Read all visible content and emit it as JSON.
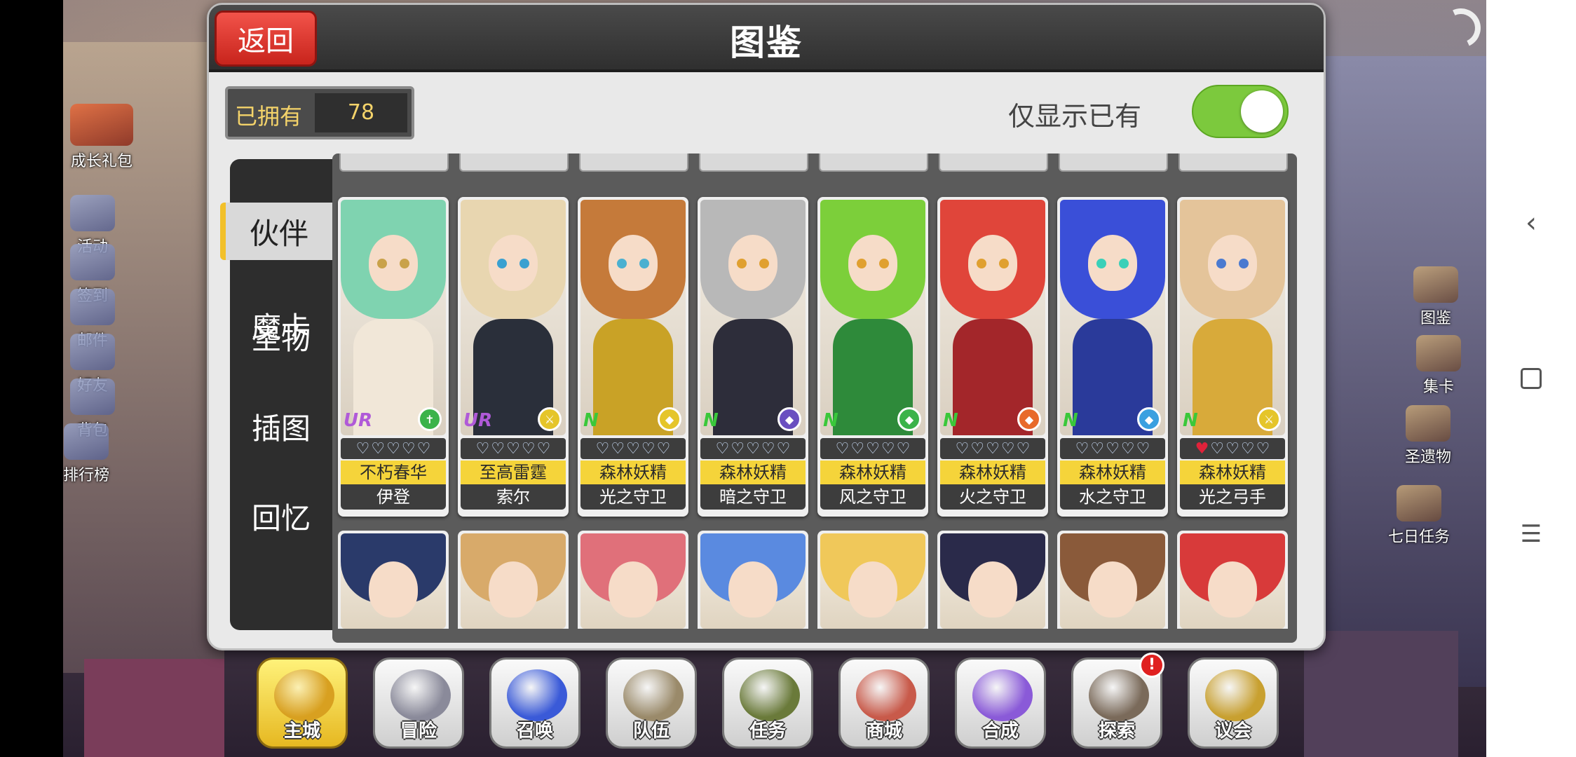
{
  "dialog": {
    "title": "图鉴",
    "back_label": "返回",
    "owned_label": "已拥有",
    "owned_count": "78",
    "filter_label": "仅显示已有",
    "filter_on": true
  },
  "tabs": [
    {
      "label": "伙伴",
      "active": true
    },
    {
      "label": "魔卡",
      "active": false
    },
    {
      "label": "圣物",
      "active": false
    },
    {
      "label": "插图",
      "active": false
    },
    {
      "label": "回忆",
      "active": false
    }
  ],
  "cards": [
    {
      "subtitle": "不朽春华",
      "name": "伊登",
      "rarity": "UR",
      "hearts": 0,
      "hair": "#7fd3b0",
      "eye": "#c9a24a",
      "wear": "#f1e7d8",
      "element_color": "#3bb34a",
      "element_icon": "cross-icon"
    },
    {
      "subtitle": "至高雷霆",
      "name": "索尔",
      "rarity": "UR",
      "hearts": 0,
      "hair": "#e8d6b0",
      "eye": "#3aa0d0",
      "wear": "#2a2f3a",
      "element_color": "#e5c52a",
      "element_icon": "sword-icon"
    },
    {
      "subtitle": "森林妖精",
      "name": "光之守卫",
      "rarity": "N",
      "hearts": 0,
      "hair": "#c57a3a",
      "eye": "#4bb0d0",
      "wear": "#c9a226",
      "element_color": "#e5c52a",
      "element_icon": "shield-icon"
    },
    {
      "subtitle": "森林妖精",
      "name": "暗之守卫",
      "rarity": "N",
      "hearts": 0,
      "hair": "#b8b8b8",
      "eye": "#e0a030",
      "wear": "#2d2d3a",
      "element_color": "#6a4fc0",
      "element_icon": "shield-icon"
    },
    {
      "subtitle": "森林妖精",
      "name": "风之守卫",
      "rarity": "N",
      "hearts": 0,
      "hair": "#7ccf3a",
      "eye": "#e0a030",
      "wear": "#2e8a3a",
      "element_color": "#3bb34a",
      "element_icon": "shield-icon"
    },
    {
      "subtitle": "森林妖精",
      "name": "火之守卫",
      "rarity": "N",
      "hearts": 0,
      "hair": "#e0453a",
      "eye": "#e0a030",
      "wear": "#a3262a",
      "element_color": "#e86a2a",
      "element_icon": "shield-icon"
    },
    {
      "subtitle": "森林妖精",
      "name": "水之守卫",
      "rarity": "N",
      "hearts": 0,
      "hair": "#3a4fd8",
      "eye": "#3ad0b8",
      "wear": "#2a3a9a",
      "element_color": "#3aa0e0",
      "element_icon": "shield-icon"
    },
    {
      "subtitle": "森林妖精",
      "name": "光之弓手",
      "rarity": "N",
      "hearts": 1,
      "hair": "#e4c49a",
      "eye": "#4b7ad0",
      "wear": "#d8aa3a",
      "element_color": "#e5c52a",
      "element_icon": "sword-icon"
    }
  ],
  "lower_cards": [
    {
      "hair": "#2a3a6a"
    },
    {
      "hair": "#d8aa6a"
    },
    {
      "hair": "#e0707a"
    },
    {
      "hair": "#5a8ae0"
    },
    {
      "hair": "#f0c85a"
    },
    {
      "hair": "#2a2a4a"
    },
    {
      "hair": "#8a5a3a"
    },
    {
      "hair": "#d83a3a"
    }
  ],
  "side_menu": [
    {
      "label": "成长礼包"
    },
    {
      "label": "活动"
    },
    {
      "label": "签到"
    },
    {
      "label": "邮件"
    },
    {
      "label": "好友"
    },
    {
      "label": "背包"
    },
    {
      "label": "排行榜"
    }
  ],
  "right_menu": [
    {
      "label": "图鉴"
    },
    {
      "label": "集卡"
    },
    {
      "label": "圣遗物"
    },
    {
      "label": "七日任务"
    }
  ],
  "bottom_nav": [
    {
      "label": "主城",
      "active": true,
      "icon": "crown-icon",
      "color": "#d8a020"
    },
    {
      "label": "冒险",
      "active": false,
      "icon": "swords-icon",
      "color": "#8a8a9a"
    },
    {
      "label": "召唤",
      "active": false,
      "icon": "summon-card-icon",
      "color": "#3a5ad8"
    },
    {
      "label": "队伍",
      "active": false,
      "icon": "winged-shield-icon",
      "color": "#9a8a6a"
    },
    {
      "label": "任务",
      "active": false,
      "icon": "quest-book-icon",
      "color": "#6a7a3a"
    },
    {
      "label": "商城",
      "active": false,
      "icon": "shop-tree-icon",
      "color": "#c85a4a"
    },
    {
      "label": "合成",
      "active": false,
      "icon": "potion-icon",
      "color": "#8a5ad8"
    },
    {
      "label": "探索",
      "active": false,
      "icon": "shovel-icon",
      "color": "#7a6a5a",
      "badge": "!"
    },
    {
      "label": "议会",
      "active": false,
      "icon": "council-emblem-icon",
      "color": "#c8a030"
    }
  ]
}
